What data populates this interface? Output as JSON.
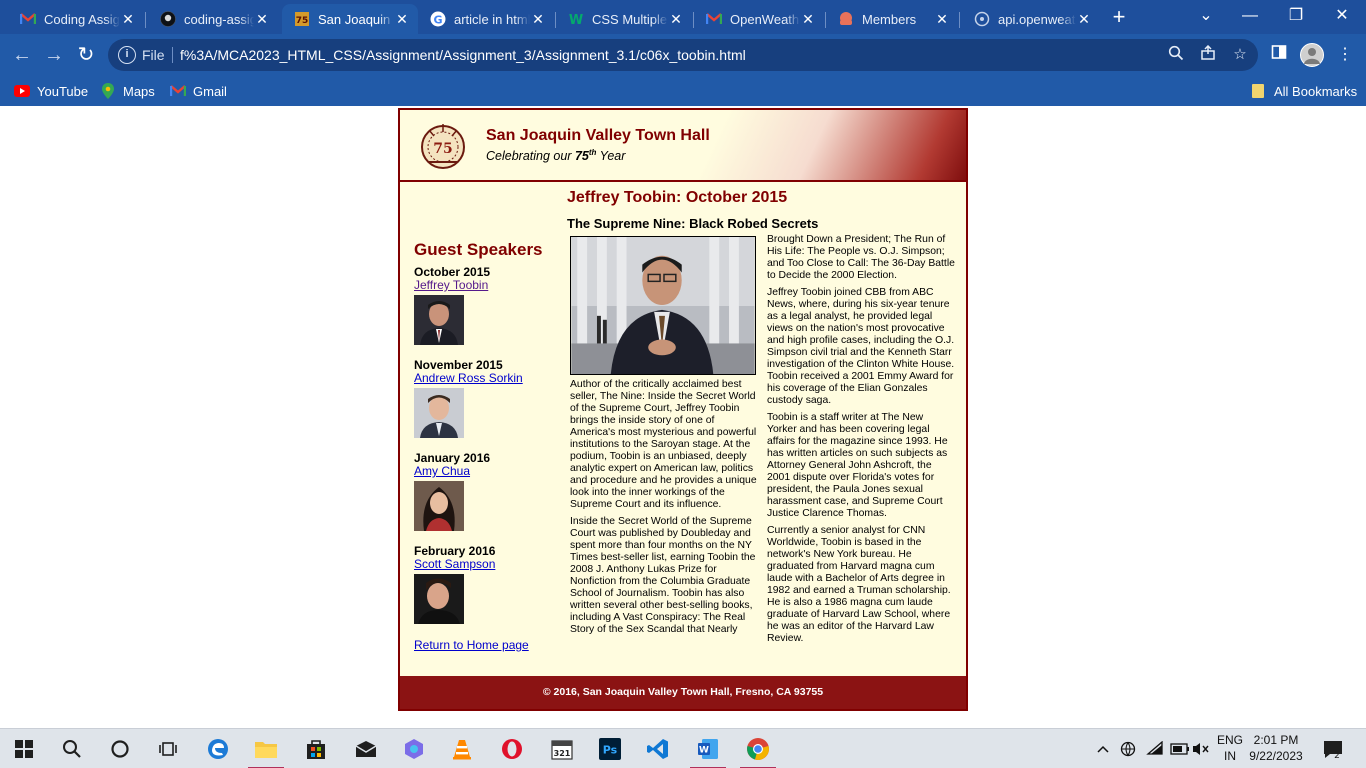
{
  "browser": {
    "tabs": [
      {
        "label": "Coding Assign",
        "favicon": "gmail-icon",
        "active": false
      },
      {
        "label": "coding-assign",
        "favicon": "github-icon",
        "active": false
      },
      {
        "label": "San Joaquin V",
        "favicon": "sjvth-icon",
        "active": true
      },
      {
        "label": "article in html",
        "favicon": "google-icon",
        "active": false
      },
      {
        "label": "CSS Multiple",
        "favicon": "w3schools-icon",
        "active": false
      },
      {
        "label": "OpenWeathe",
        "favicon": "gmail-icon",
        "active": false
      },
      {
        "label": "Members",
        "favicon": "octopus-icon",
        "active": false
      },
      {
        "label": "api.openweat",
        "favicon": "globe-icon",
        "active": false
      }
    ],
    "omnibox": {
      "scheme_label": "File",
      "url": "f%3A/MCA2023_HTML_CSS/Assignment/Assignment_3/Assignment_3.1/c06x_toobin.html"
    },
    "bookmarks": [
      {
        "label": "YouTube",
        "icon": "youtube-icon"
      },
      {
        "label": "Maps",
        "icon": "maps-icon"
      },
      {
        "label": "Gmail",
        "icon": "gmail-icon"
      }
    ],
    "all_bookmarks_label": "All Bookmarks"
  },
  "page": {
    "header": {
      "title": "San Joaquin Valley Town Hall",
      "subtitle_pre": "Celebrating our ",
      "subtitle_num": "75",
      "subtitle_sup": "th",
      "subtitle_post": " Year",
      "logo_text": "75"
    },
    "aside": {
      "heading": "Guest Speakers",
      "speakers": [
        {
          "month": "October 2015",
          "name": "Jeffrey Toobin",
          "visited": true
        },
        {
          "month": "November 2015",
          "name": "Andrew Ross Sorkin",
          "visited": false
        },
        {
          "month": "January 2016",
          "name": "Amy Chua",
          "visited": false
        },
        {
          "month": "February 2016",
          "name": "Scott Sampson",
          "visited": false
        }
      ],
      "home_link": "Return to Home page"
    },
    "article": {
      "title": "Jeffrey Toobin: October 2015",
      "subtitle": "The Supreme Nine: Black Robed Secrets",
      "left_paragraphs": [
        "Author of the critically acclaimed best seller, The Nine: Inside the Secret World of the Supreme Court, Jeffrey Toobin brings the inside story of one of America's most mysterious and powerful institutions to the Saroyan stage. At the podium, Toobin is an unbiased, deeply analytic expert on American law, politics and procedure and he provides a unique look into the inner workings of the Supreme Court and its influence.",
        "Inside the Secret World of the Supreme Court was published by Doubleday and spent more than four months on the NY Times best-seller list, earning Toobin the 2008 J. Anthony Lukas Prize for Nonfiction from the Columbia Graduate School of Journalism. Toobin has also written several other best-selling books, including A Vast Conspiracy: The Real Story of the Sex Scandal that Nearly"
      ],
      "right_paragraphs": [
        "Brought Down a President; The Run of His Life: The People vs. O.J. Simpson; and Too Close to Call: The 36-Day Battle to Decide the 2000 Election.",
        "Jeffrey Toobin joined CBB from ABC News, where, during his six-year tenure as a legal analyst, he provided legal views on the nation's most provocative and high profile cases, including the O.J. Simpson civil trial and the Kenneth Starr investigation of the Clinton White House. Toobin received a 2001 Emmy Award for his coverage of the Elian Gonzales custody saga.",
        "Toobin is a staff writer at The New Yorker and has been covering legal affairs for the magazine since 1993. He has written articles on such subjects as Attorney General John Ashcroft, the 2001 dispute over Florida's votes for president, the Paula Jones sexual harassment case, and Supreme Court Justice Clarence Thomas.",
        "Currently a senior analyst for CNN Worldwide, Toobin is based in the network's New York bureau. He graduated from Harvard magna cum laude with a Bachelor of Arts degree in 1982 and earned a Truman scholarship. He is also a 1986 magna cum laude graduate of Harvard Law School, where he was an editor of the Harvard Law Review."
      ]
    },
    "footer": "© 2016, San Joaquin Valley Town Hall, Fresno, CA 93755"
  },
  "taskbar": {
    "language": [
      "ENG",
      "IN"
    ],
    "time": "2:01 PM",
    "date": "9/22/2023",
    "notification_count": "2"
  },
  "colors": {
    "chrome_blue": "#1e4f9c",
    "brand_maroon": "#800000",
    "page_cream": "#fffcdf"
  }
}
